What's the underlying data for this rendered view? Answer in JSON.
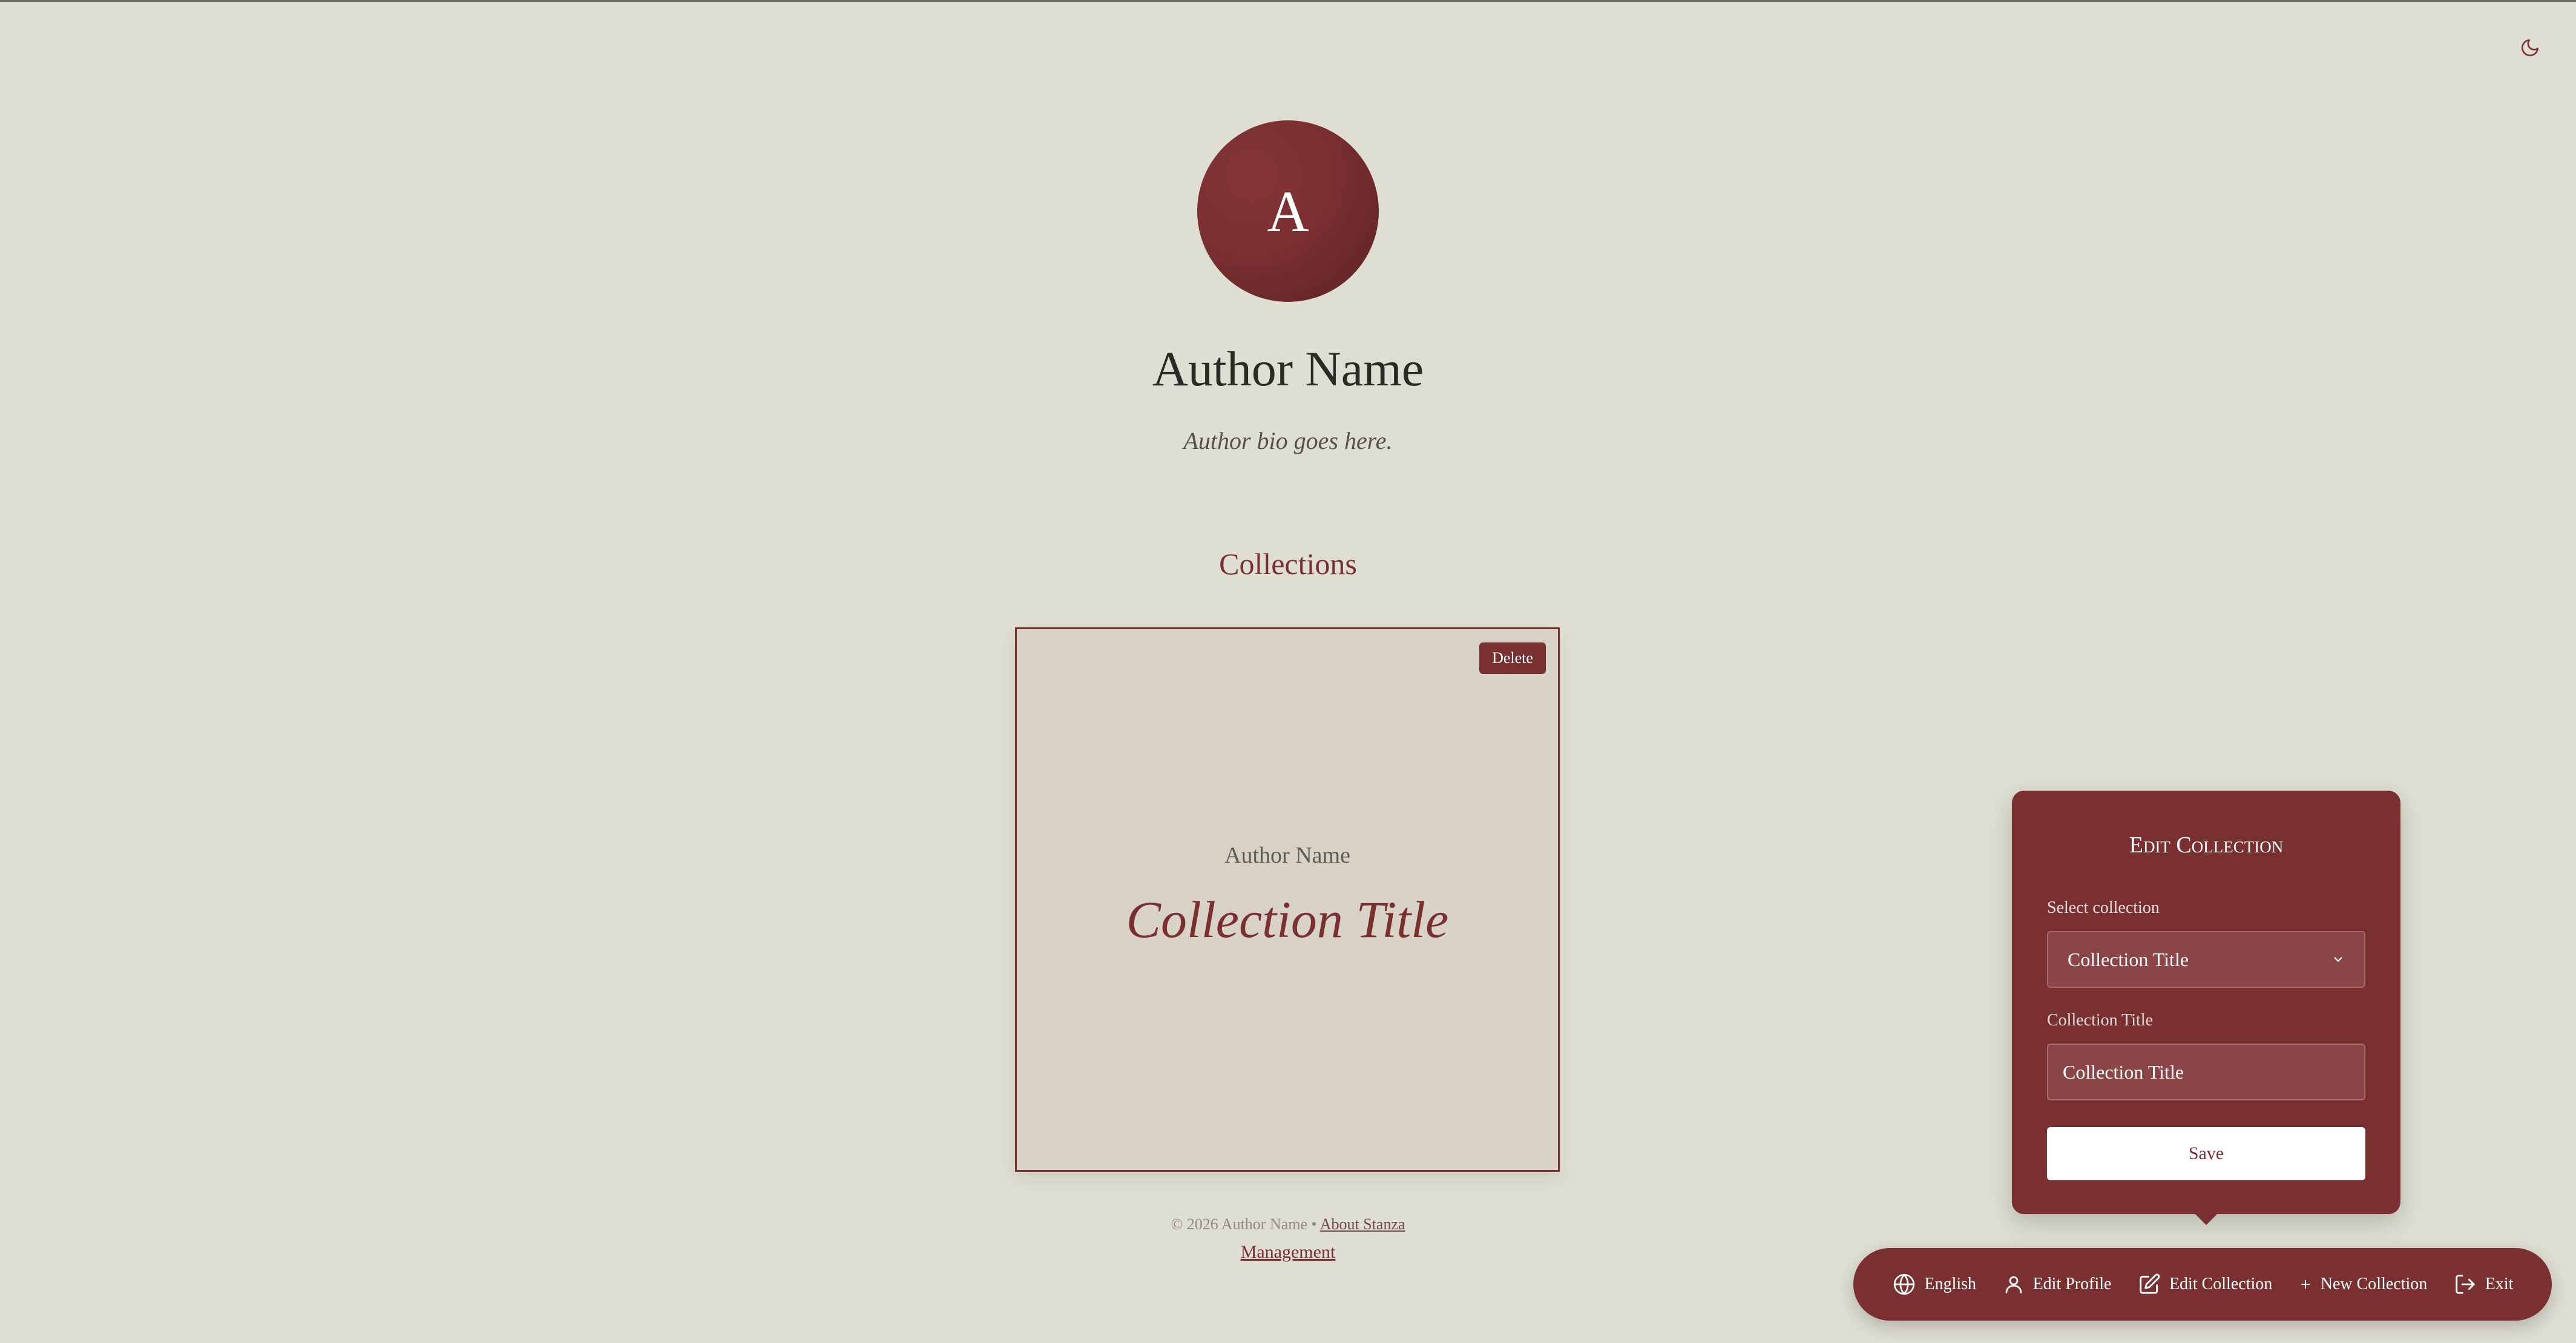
{
  "profile": {
    "avatar_initial": "A",
    "name": "Author Name",
    "bio": "Author bio goes here."
  },
  "collections": {
    "section_title": "Collections",
    "items": [
      {
        "author": "Author Name",
        "title": "Collection Title",
        "delete_label": "Delete"
      }
    ]
  },
  "footer": {
    "copyright": "© 2026 Author Name •",
    "about_link": "About Stanza",
    "management_link": "Management"
  },
  "edit_panel": {
    "title": "Edit Collection",
    "select_label": "Select collection",
    "select_value": "Collection Title",
    "title_label": "Collection Title",
    "title_value": "Collection Title",
    "save_label": "Save"
  },
  "toolbar": {
    "language": "English",
    "edit_profile": "Edit Profile",
    "edit_collection": "Edit Collection",
    "new_collection": "New Collection",
    "exit": "Exit"
  },
  "colors": {
    "accent": "#7a2f31",
    "background": "#dfded2",
    "card_background": "#d9d2c7"
  },
  "icons": {
    "theme_toggle": "moon-icon",
    "language": "globe-icon",
    "edit_profile": "user-icon",
    "edit_collection": "edit-icon",
    "new_collection": "plus-icon",
    "exit": "logout-icon"
  }
}
